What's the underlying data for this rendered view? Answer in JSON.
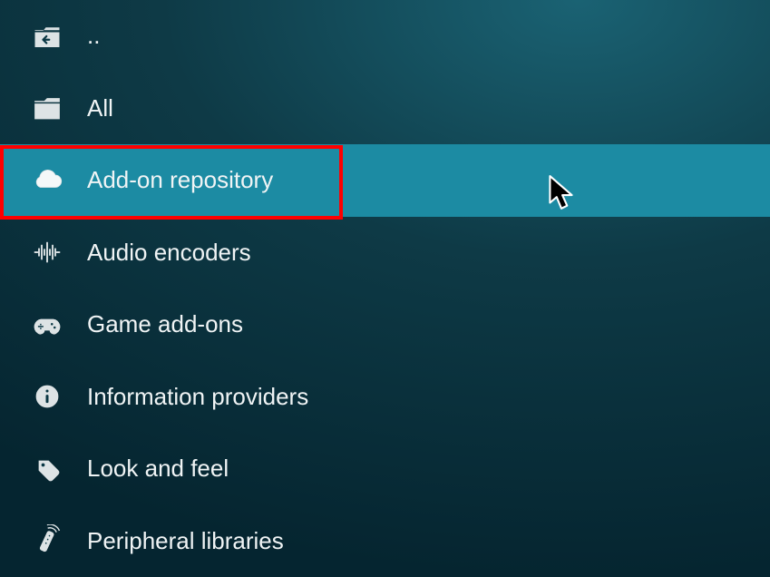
{
  "list": {
    "items": [
      {
        "icon": "folder-back-icon",
        "label": ".."
      },
      {
        "icon": "folder-icon",
        "label": "All"
      },
      {
        "icon": "cloud-icon",
        "label": "Add-on repository",
        "selected": true
      },
      {
        "icon": "waveform-icon",
        "label": "Audio encoders"
      },
      {
        "icon": "gamepad-icon",
        "label": "Game add-ons"
      },
      {
        "icon": "info-icon",
        "label": "Information providers"
      },
      {
        "icon": "tag-icon",
        "label": "Look and feel"
      },
      {
        "icon": "remote-icon",
        "label": "Peripheral libraries"
      }
    ]
  }
}
